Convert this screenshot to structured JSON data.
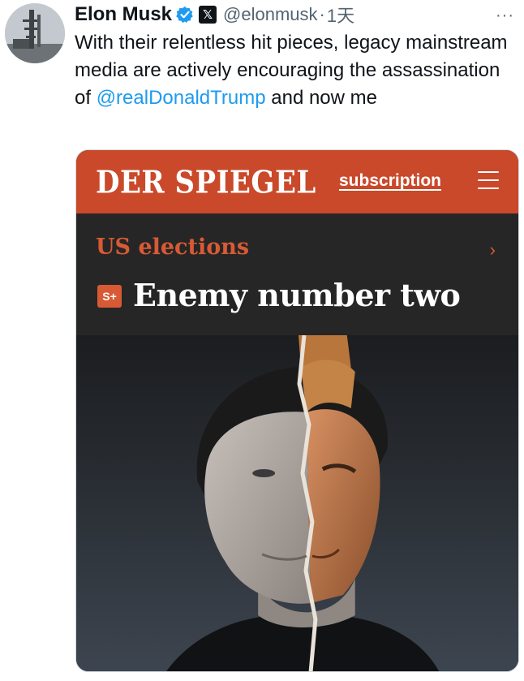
{
  "tweet": {
    "author_name": "Elon Musk",
    "handle": "@elonmusk",
    "separator": "·",
    "time": "1天",
    "more_label": "···",
    "x_badge": "𝕏",
    "text_before": "With their relentless hit pieces, legacy mainstream media are actively  encouraging the assassination of ",
    "mention": "@realDonaldTrump",
    "text_after": " and now me"
  },
  "media": {
    "logo": "DER SPIEGEL",
    "subscription": "subscription",
    "kicker": "US elections",
    "chevron": "›",
    "plus_badge": "S+",
    "headline": "Enemy number two"
  },
  "colors": {
    "spiegel_red": "#c9492a",
    "kicker_orange": "#d85a35",
    "band_dark": "#262626",
    "link_blue": "#1d9bf0",
    "verified_blue": "#1d9bf0"
  },
  "icons": {
    "verified": "verified-badge-icon",
    "x": "x-logo-icon",
    "more": "more-options-icon",
    "menu": "hamburger-menu-icon"
  }
}
